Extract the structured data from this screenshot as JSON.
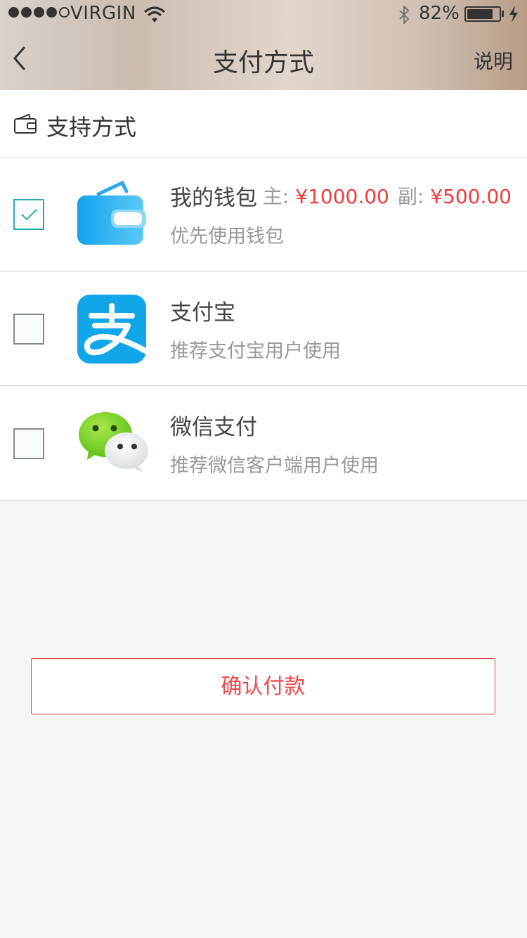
{
  "status_bar": {
    "carrier": "VIRGIN",
    "battery_percent": "82%",
    "signal_bars_filled": 4,
    "signal_bars_total": 5,
    "battery_level": 0.82
  },
  "nav": {
    "title": "支付方式",
    "right_button": "说明",
    "back_icon": "chevron-left-icon"
  },
  "section": {
    "title": "支持方式",
    "icon": "wallet-outline-icon"
  },
  "methods": [
    {
      "name": "我的钱包",
      "description": "优先使用钱包",
      "checked": true,
      "icon": "wallet-logo-icon",
      "balance": {
        "main_label": "主:",
        "main_amount": "¥1000.00",
        "sub_label": "副:",
        "sub_amount": "¥500.00"
      }
    },
    {
      "name": "支付宝",
      "description": "推荐支付宝用户使用",
      "checked": false,
      "icon": "alipay-logo-icon"
    },
    {
      "name": "微信支付",
      "description": "推荐微信客户端用户使用",
      "checked": false,
      "icon": "wechat-logo-icon"
    }
  ],
  "confirm_button": "确认付款",
  "colors": {
    "accent_red": "#f04848",
    "check_teal": "#2aaab8",
    "alipay_blue": "#10a6e8",
    "wechat_green": "#7bd321",
    "wallet_blue": "#2fb0ef"
  }
}
